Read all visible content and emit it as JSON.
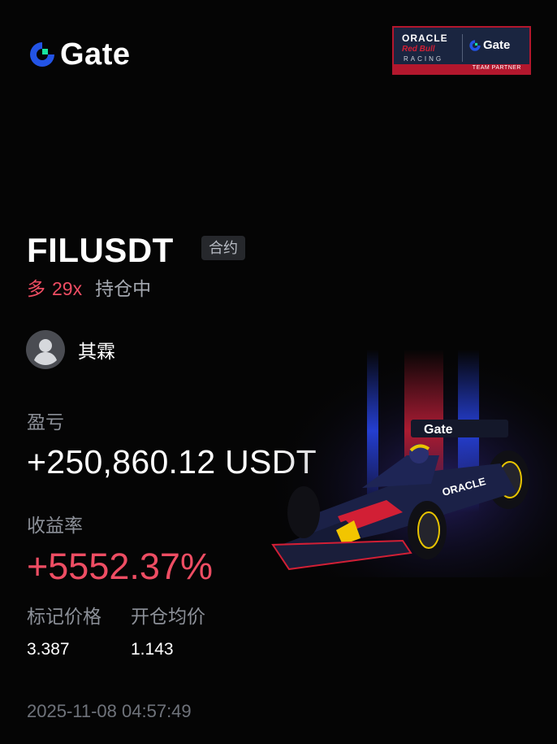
{
  "brand": {
    "name": "Gate"
  },
  "partner": {
    "oracle": "ORACLE",
    "redbull": "Red Bull",
    "racing": "RACING",
    "gate": "Gate",
    "tag": "TEAM PARTNER"
  },
  "position": {
    "symbol": "FILUSDT",
    "market_type": "合约",
    "direction": "多",
    "leverage": "29x",
    "status": "持仓中"
  },
  "user": {
    "name": "其霖"
  },
  "pnl": {
    "label": "盈亏",
    "value": "+250,860.12 USDT"
  },
  "roi": {
    "label": "收益率",
    "value": "+5552.37%"
  },
  "prices": {
    "mark_label": "标记价格",
    "mark_value": "3.387",
    "entry_label": "开仓均价",
    "entry_value": "1.143"
  },
  "timestamp": "2025-11-08 04:57:49",
  "colors": {
    "long": "#ee4d63",
    "brand_blue": "#2354e6",
    "brand_green": "#17e6a1"
  }
}
